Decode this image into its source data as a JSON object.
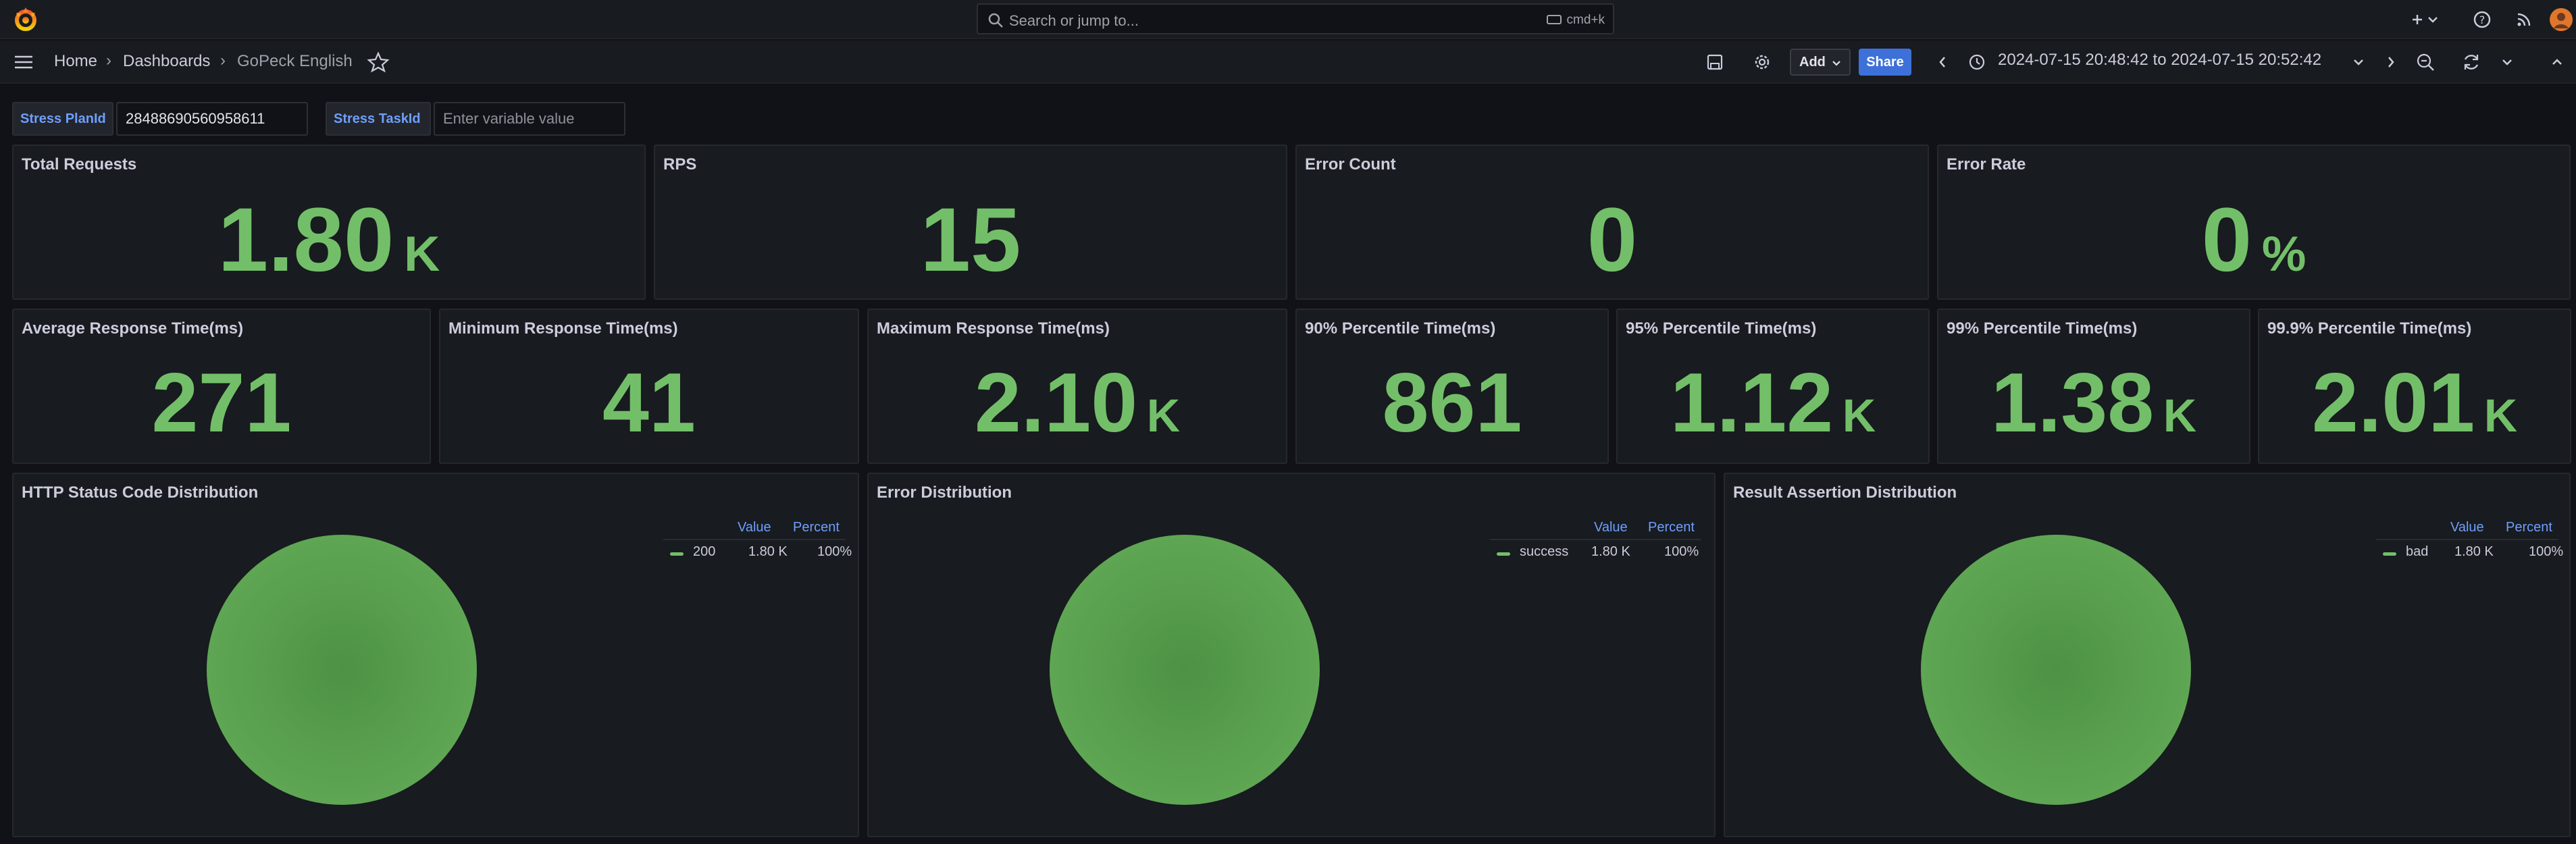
{
  "topbar": {
    "search_placeholder": "Search or jump to...",
    "search_shortcut": "cmd+k",
    "icons": [
      "grafana-logo-icon",
      "search-icon",
      "plus-icon",
      "chevron-down-icon",
      "help-icon",
      "rss-icon",
      "avatar"
    ]
  },
  "breadcrumb": {
    "home": "Home",
    "dashboards": "Dashboards",
    "current": "GoPeck English",
    "separator": "›"
  },
  "toolbar": {
    "add_label": "Add",
    "share_label": "Share",
    "time_range": "2024-07-15 20:48:42 to 2024-07-15 20:52:42"
  },
  "variables": {
    "plan_label": "Stress PlanId",
    "plan_value": "28488690560958611",
    "task_label": "Stress TaskId",
    "task_placeholder": "Enter variable value"
  },
  "stats_row1": [
    {
      "title": "Total Requests",
      "value": "1.80",
      "unit": "K"
    },
    {
      "title": "RPS",
      "value": "15",
      "unit": ""
    },
    {
      "title": "Error Count",
      "value": "0",
      "unit": ""
    },
    {
      "title": "Error Rate",
      "value": "0",
      "unit": "%"
    }
  ],
  "stats_row2": [
    {
      "title": "Average Response Time(ms)",
      "value": "271",
      "unit": ""
    },
    {
      "title": "Minimum Response Time(ms)",
      "value": "41",
      "unit": ""
    },
    {
      "title": "Maximum Response Time(ms)",
      "value": "2.10",
      "unit": "K"
    },
    {
      "title": "90% Percentile Time(ms)",
      "value": "861",
      "unit": ""
    },
    {
      "title": "95% Percentile Time(ms)",
      "value": "1.12",
      "unit": "K"
    },
    {
      "title": "99% Percentile Time(ms)",
      "value": "1.38",
      "unit": "K"
    },
    {
      "title": "99.9% Percentile Time(ms)",
      "value": "2.01",
      "unit": "K"
    }
  ],
  "pies": [
    {
      "title": "HTTP Status Code Distribution",
      "legend_value": "Value",
      "legend_percent": "Percent",
      "item": "200",
      "value": "1.80 K",
      "percent": "100%"
    },
    {
      "title": "Error Distribution",
      "legend_value": "Value",
      "legend_percent": "Percent",
      "item": "success",
      "value": "1.80 K",
      "percent": "100%"
    },
    {
      "title": "Result Assertion Distribution",
      "legend_value": "Value",
      "legend_percent": "Percent",
      "item": "bad",
      "value": "1.80 K",
      "percent": "100%"
    }
  ],
  "colors": {
    "accent_green": "#73bf69",
    "link_blue": "#6e9fff",
    "share_blue": "#3d71d9",
    "background": "#111217",
    "panel": "#181b1f"
  }
}
